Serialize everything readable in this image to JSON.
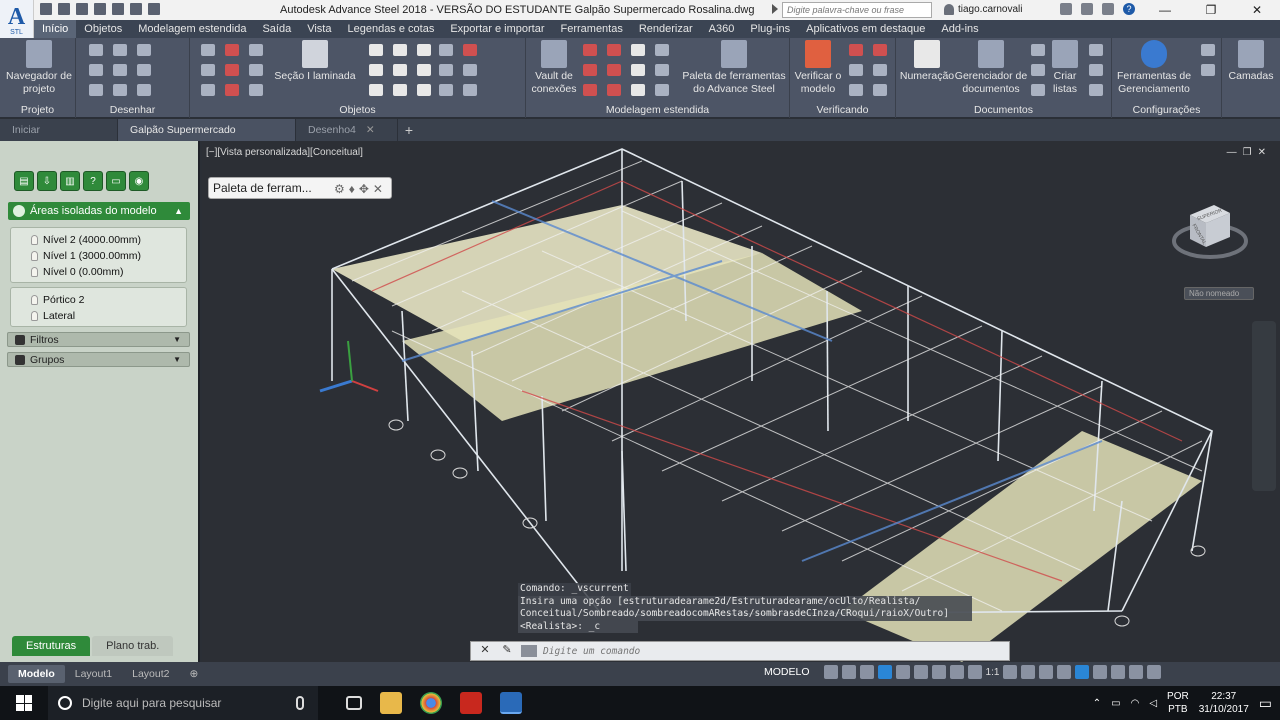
{
  "app": {
    "logo": "A",
    "logo_sub": "STL"
  },
  "title": "Autodesk Advance Steel 2018 - VERSÃO DO ESTUDANTE    Galpão Supermercado Rosalina.dwg",
  "search_placeholder": "Digite palavra-chave ou frase",
  "user": "tiago.carnovali",
  "menu_tabs": [
    "Início",
    "Objetos",
    "Modelagem estendida",
    "Saída",
    "Vista",
    "Legendas e cotas",
    "Exportar e importar",
    "Ferramentas",
    "Renderizar",
    "A360",
    "Plug-ins",
    "Aplicativos em destaque",
    "Add-ins"
  ],
  "ribbon": {
    "projeto": {
      "button": "Navegador de projeto",
      "label": "Projeto"
    },
    "desenhar": {
      "label": "Desenhar"
    },
    "objetos": {
      "button": "Seção I laminada",
      "label": "Objetos"
    },
    "modelagem": {
      "vault": "Vault de conexões",
      "paleta": "Paleta de ferramentas do Advance Steel",
      "label": "Modelagem estendida"
    },
    "verificando": {
      "button": "Verificar o modelo",
      "label": "Verificando"
    },
    "documentos": {
      "num": "Numeração",
      "ger": "Gerenciador de documentos",
      "listas": "Criar listas",
      "label": "Documentos"
    },
    "config": {
      "button": "Ferramentas de Gerenciamento",
      "label": "Configurações"
    },
    "camadas": {
      "button": "Camadas"
    }
  },
  "doc_tabs": [
    {
      "label": "Iniciar"
    },
    {
      "label": "Galpão Supermercado Rosalina*"
    },
    {
      "label": "Desenho4"
    }
  ],
  "left_panel": {
    "header": "Áreas isoladas do modelo",
    "levels": [
      "Nível 2 (4000.00mm)",
      "Nível 1 (3000.00mm)",
      "Nível 0 (0.00mm)"
    ],
    "frames": [
      "Pórtico 2",
      "Lateral"
    ],
    "filtros": "Filtros",
    "grupos": "Grupos",
    "tab_active": "Estruturas",
    "tab_inactive": "Plano trab."
  },
  "viewport": {
    "label": "[−][Vista personalizada][Conceitual]",
    "palette": "Paleta de ferram...",
    "viewcube_name": "Não nomeado",
    "cube_top": "SUPERIOR",
    "cube_front": "FRONTAL"
  },
  "command": {
    "line0": "Comando: _vscurrent",
    "line1": "Insira uma opção [estruturadearame2d/Estruturadearame/ocUlto/Realista/",
    "line2": "Conceitual/Sombreado/sombreadocomARestas/sombrasdeCInza/CRoqui/raioX/Outro]",
    "line3": "<Realista>: _c",
    "placeholder": "Digite um comando"
  },
  "layouts": [
    "Modelo",
    "Layout1",
    "Layout2"
  ],
  "status": {
    "modelo": "MODELO",
    "scale": "1:1"
  },
  "taskbar": {
    "search": "Digite aqui para pesquisar",
    "lang1": "POR",
    "lang2": "PTB",
    "time": "22:37",
    "date": "31/10/2017"
  }
}
